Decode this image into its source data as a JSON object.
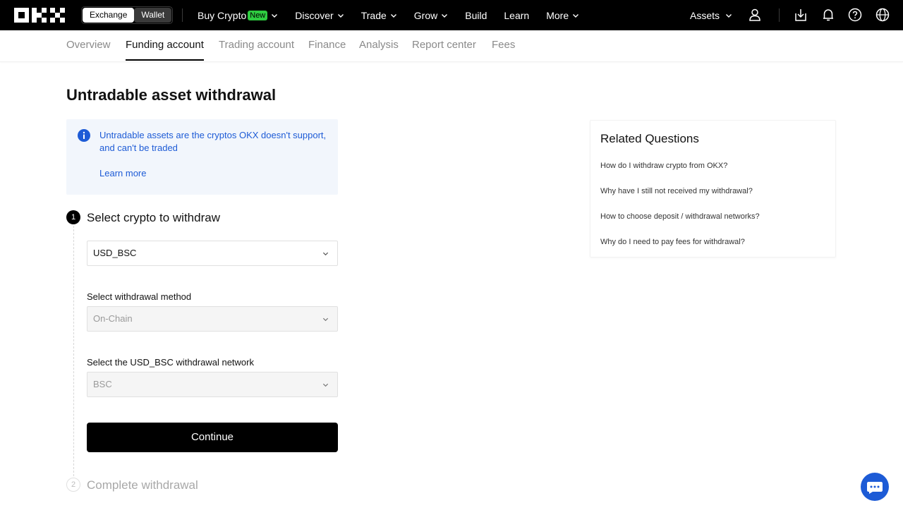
{
  "mode_switch": {
    "exchange": "Exchange",
    "wallet": "Wallet"
  },
  "nav": {
    "buy_crypto": "Buy Crypto",
    "new_badge": "New",
    "discover": "Discover",
    "trade": "Trade",
    "grow": "Grow",
    "build": "Build",
    "learn": "Learn",
    "more": "More",
    "assets": "Assets"
  },
  "subtabs": [
    "Overview",
    "Funding account",
    "Trading account",
    "Finance",
    "Analysis",
    "Report center",
    "Fees"
  ],
  "page_title": "Untradable asset withdrawal",
  "info": {
    "text": "Untradable assets are the cryptos OKX doesn't support, and can't be traded",
    "learn_more": "Learn more"
  },
  "step1": {
    "number": "1",
    "title": "Select crypto to withdraw",
    "crypto_value": "USD_BSC",
    "method_label": "Select withdrawal method",
    "method_value": "On-Chain",
    "network_label": "Select the USD_BSC withdrawal network",
    "network_value": "BSC",
    "continue": "Continue"
  },
  "step2": {
    "number": "2",
    "title": "Complete withdrawal"
  },
  "related": {
    "title": "Related Questions",
    "questions": [
      "How do I withdraw crypto from OKX?",
      "Why have I still not received my withdrawal?",
      "How to choose deposit / withdrawal networks?",
      "Why do I need to pay fees for withdrawal?"
    ]
  },
  "colors": {
    "accent_blue": "#1d5bd6",
    "new_badge": "#2ecc40",
    "info_bg": "#f2f6fc"
  },
  "icons": [
    "okx-logo",
    "chevron-down-icon",
    "user-icon",
    "download-icon",
    "bell-icon",
    "help-icon",
    "globe-icon",
    "info-icon",
    "chat-icon"
  ]
}
